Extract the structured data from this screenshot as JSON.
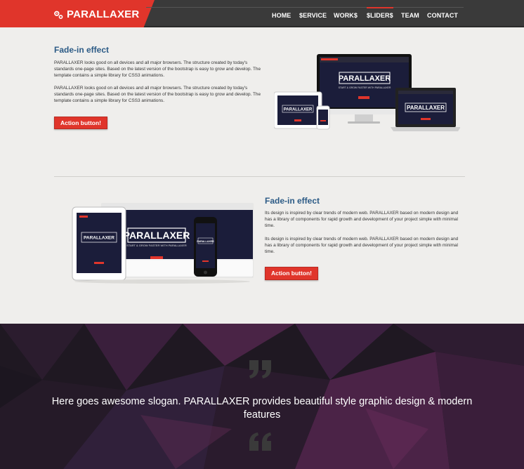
{
  "brand": {
    "name": "PARALLAXER",
    "icon": "gears-icon"
  },
  "nav": [
    {
      "label": "HOME",
      "active": false
    },
    {
      "label": "$ERVICE",
      "active": false
    },
    {
      "label": "WORK$",
      "active": false
    },
    {
      "label": "$LIDER$",
      "active": true
    },
    {
      "label": "TEAM",
      "active": false
    },
    {
      "label": "CONTACT",
      "active": false
    }
  ],
  "section1": {
    "title": "Fade-in effect",
    "paragraph1": "PARALLAXER looks good on all devices and all major browsers. The structure created by today's standards one-page sites. Based on the latest version of the bootstrap is easy to grow and develop. The template contains a simple library for CSS3 animations.",
    "paragraph2": "PARALLAXER looks good on all devices and all major browsers. The structure created by today's standards one-page sites. Based on the latest version of the bootstrap is easy to grow and develop. The template contains a simple library for CSS3 animations.",
    "button": "Action button!",
    "image_brand": "PARALLAXER",
    "image_tagline": "START & GROW FASTER WITH PARALLAXER"
  },
  "section2": {
    "title": "Fade-in effect",
    "paragraph1": "Its design is inspired by clear trends of modern web. PARALLAXER based on modern design and has a library of components for rapid growth and development of your project simple with minimal time.",
    "paragraph2": "Its design is inspired by clear trends of modern web. PARALLAXER based on modern design and has a library of components for rapid growth and development of your project simple with minimal time.",
    "button": "Action button!",
    "image_brand": "PARALLAXER",
    "image_tagline": "START & GROW FASTER WITH PARALLAXER"
  },
  "slogan": {
    "text": "Here goes awesome slogan. PARALLAXER provides beautiful style graphic design & modern features",
    "open_quote_icon": "quote-open-icon",
    "close_quote_icon": "quote-close-icon"
  },
  "colors": {
    "accent": "#e0352b",
    "header": "#3a3a3a",
    "heading": "#2c5b86",
    "band": "#1f1822"
  }
}
